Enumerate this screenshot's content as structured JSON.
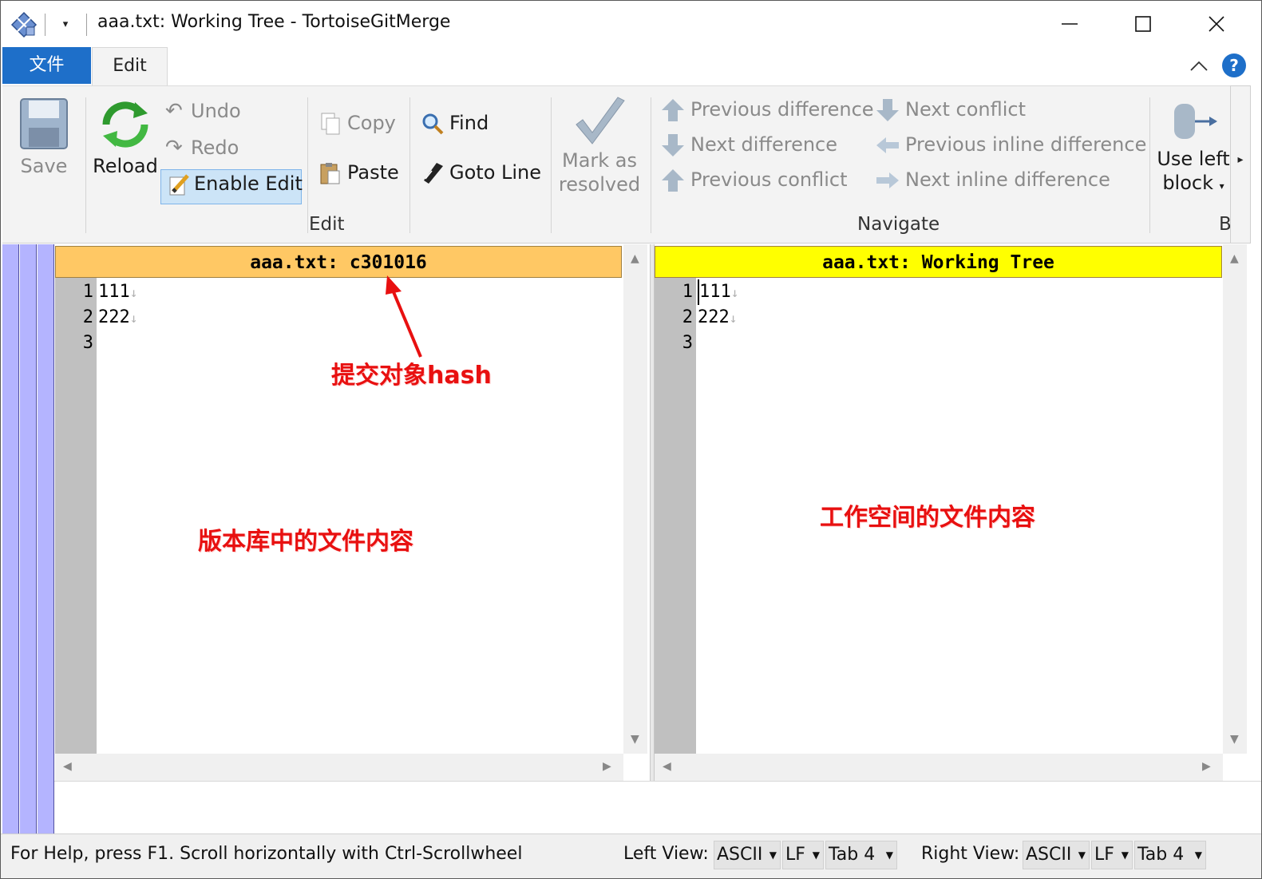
{
  "window": {
    "title": "aaa.txt: Working Tree - TortoiseGitMerge",
    "qat_dropdown": "▾"
  },
  "tabs": {
    "file": "文件",
    "edit": "Edit",
    "help": "?"
  },
  "ribbon": {
    "edit_group": {
      "label": "Edit",
      "save": "Save",
      "reload": "Reload",
      "undo": "Undo",
      "redo": "Redo",
      "enable_edit": "Enable Edit",
      "copy": "Copy",
      "paste": "Paste",
      "find": "Find",
      "goto_line": "Goto Line",
      "mark_resolved_line1": "Mark as",
      "mark_resolved_line2": "resolved"
    },
    "navigate_group": {
      "label": "Navigate",
      "previous_difference": "Previous difference",
      "next_difference": "Next difference",
      "previous_conflict": "Previous conflict",
      "next_conflict": "Next conflict",
      "previous_inline_difference": "Previous inline difference",
      "next_inline_difference": "Next inline difference"
    },
    "block_group": {
      "label_partial": "B",
      "use_left_line1": "Use left",
      "use_left_line2": "block"
    },
    "scroll_right": "▸"
  },
  "left_pane": {
    "header": "aaa.txt: c301016",
    "header_color": "#ffc864",
    "lines": [
      {
        "num": "1",
        "text": "111"
      },
      {
        "num": "2",
        "text": "222"
      },
      {
        "num": "3",
        "text": ""
      }
    ]
  },
  "right_pane": {
    "header": "aaa.txt: Working Tree",
    "header_color": "#ffff00",
    "lines": [
      {
        "num": "1",
        "text": "111"
      },
      {
        "num": "2",
        "text": "222"
      },
      {
        "num": "3",
        "text": ""
      }
    ]
  },
  "annotations": {
    "hash_label": "提交对象hash",
    "left_label": "版本库中的文件内容",
    "right_label": "工作空间的文件内容"
  },
  "statusbar": {
    "help_text": "For Help, press F1. Scroll horizontally with Ctrl-Scrollwheel",
    "left_view_label": "Left View:",
    "right_view_label": "Right View:",
    "left_encoding": "ASCII",
    "left_eol": "LF",
    "left_tab": "Tab 4",
    "right_encoding": "ASCII",
    "right_eol": "LF",
    "right_tab": "Tab 4"
  },
  "colors": {
    "accent": "#1e6fc9",
    "annotation": "#e81010",
    "location_bar": "#b4b4ff"
  }
}
